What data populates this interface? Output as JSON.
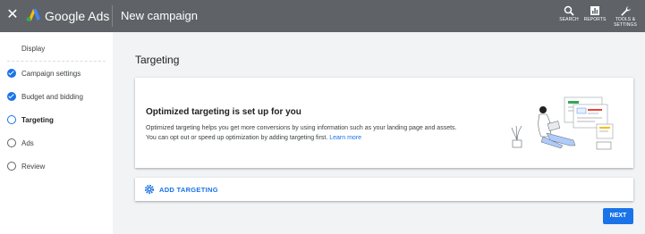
{
  "header": {
    "close_icon": "close-icon",
    "brand": "Google Ads",
    "page_title": "New campaign",
    "tools": [
      {
        "label": "SEARCH",
        "icon": "search-icon"
      },
      {
        "label": "REPORTS",
        "icon": "reports-icon"
      },
      {
        "label_line1": "TOOLS &",
        "label_line2": "SETTINGS",
        "icon": "wrench-icon"
      }
    ],
    "bg_color": "#5f6368"
  },
  "sidebar": {
    "top_label": "Display",
    "steps": [
      {
        "label": "Campaign settings",
        "state": "done"
      },
      {
        "label": "Budget and bidding",
        "state": "done"
      },
      {
        "label": "Targeting",
        "state": "current"
      },
      {
        "label": "Ads",
        "state": "todo"
      },
      {
        "label": "Review",
        "state": "todo"
      }
    ]
  },
  "main": {
    "section_title": "Targeting",
    "card": {
      "title": "Optimized targeting is set up for you",
      "body_line1": "Optimized targeting helps you get more conversions by using information such as your landing page and assets.",
      "body_line2": "You can opt out or speed up optimization by adding targeting first.",
      "link": "Learn more",
      "illustration": "person-with-laptop-illustration"
    },
    "add_targeting": "ADD TARGETING",
    "next_button": "NEXT"
  },
  "colors": {
    "accent": "#1a73e8",
    "background": "#f1f3f4"
  }
}
